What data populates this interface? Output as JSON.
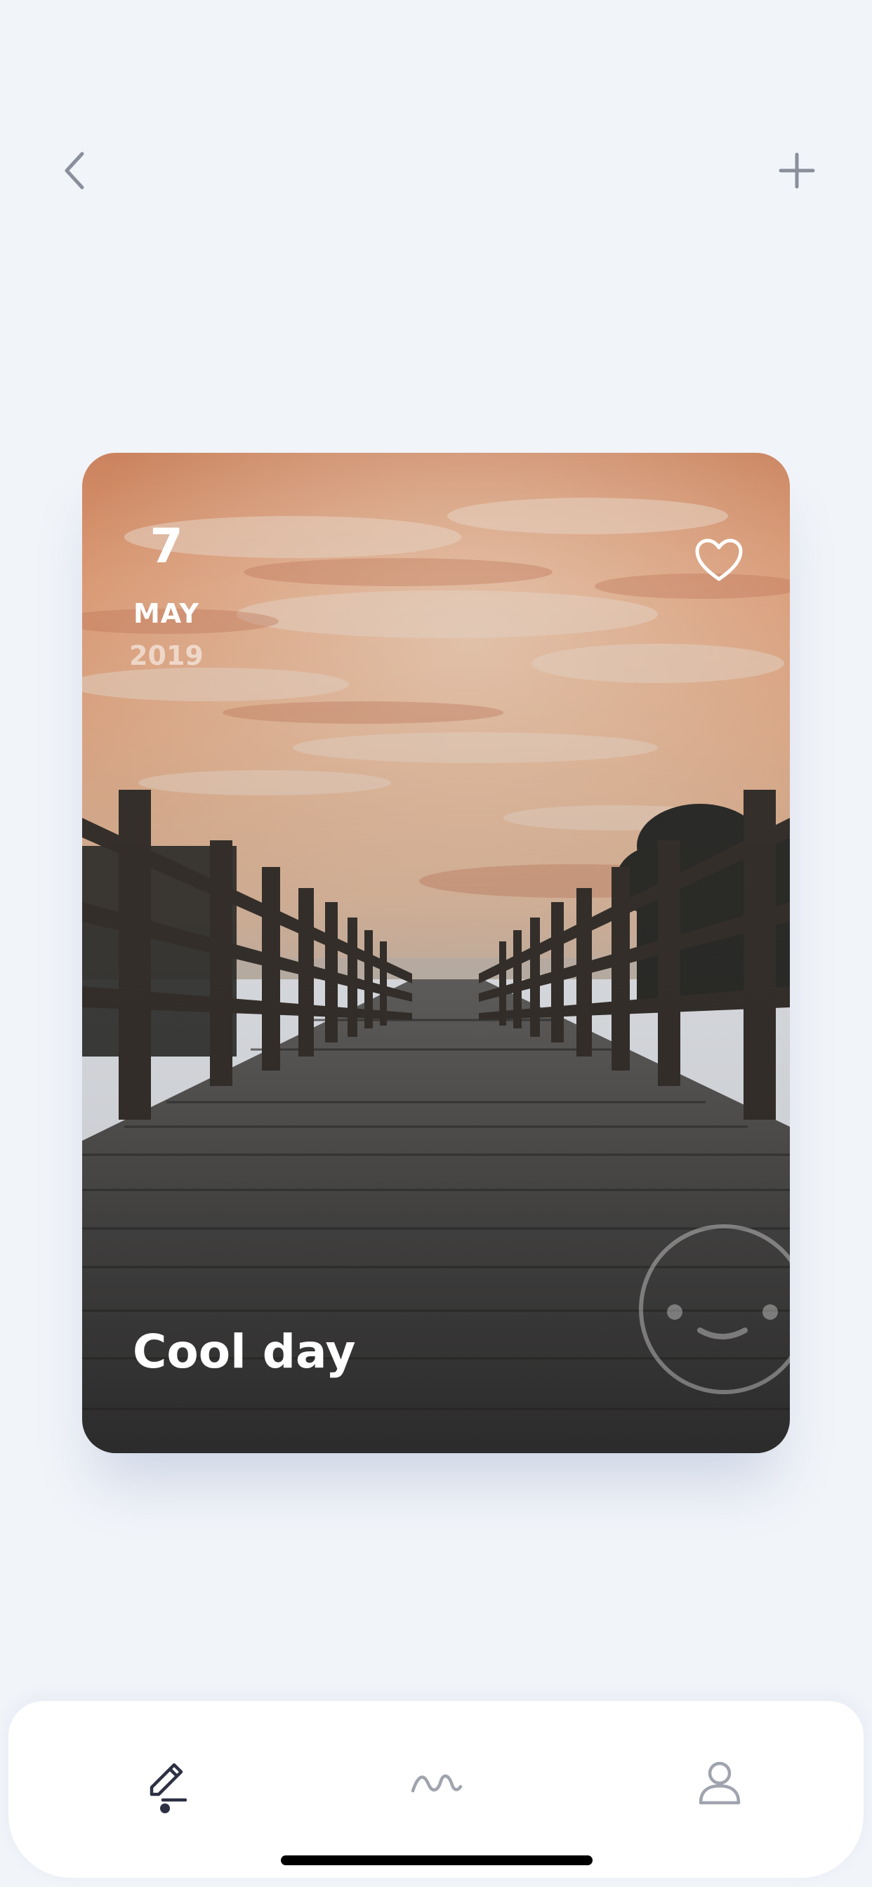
{
  "header": {
    "back_icon": "chevron-left-icon",
    "add_icon": "plus-icon"
  },
  "entry": {
    "day": "7",
    "month": "MAY",
    "year": "2019",
    "caption": "Cool day",
    "favorite_icon": "heart-outline-icon",
    "mood_icon": "smiley-face-icon",
    "photo": "sunset-boardwalk-photo"
  },
  "bottom_nav": {
    "items": [
      {
        "icon": "pencil-icon",
        "active": true
      },
      {
        "icon": "wave-icon",
        "active": false
      },
      {
        "icon": "user-icon",
        "active": false
      }
    ]
  },
  "colors": {
    "background": "#f1f4f9",
    "icon_gray": "#8a8f9c",
    "icon_dark": "#2d3142",
    "nav_background": "#ffffff"
  }
}
